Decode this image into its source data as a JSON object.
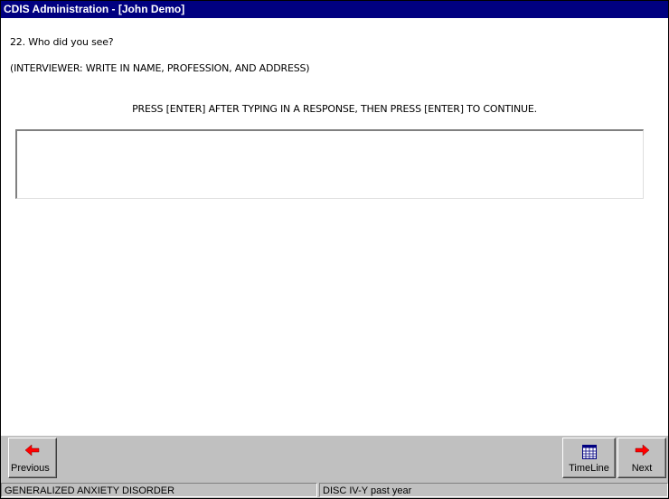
{
  "window": {
    "title": "CDIS Administration - [John Demo]"
  },
  "question": {
    "text": "22. Who did you see?",
    "instruction": "(INTERVIEWER: WRITE IN NAME, PROFESSION, AND ADDRESS)",
    "press_instruction": "PRESS [ENTER] AFTER TYPING IN A RESPONSE, THEN PRESS [ENTER] TO CONTINUE.",
    "response_value": ""
  },
  "toolbar": {
    "previous_label": "Previous",
    "previous_icon": "left-arrow-icon",
    "timeline_label": "TimeLine",
    "timeline_icon": "calendar-icon",
    "next_label": "Next",
    "next_icon": "right-arrow-icon"
  },
  "status": {
    "section": "GENERALIZED ANXIETY DISORDER",
    "module": "DISC IV-Y past year"
  },
  "colors": {
    "titlebar": "#000080",
    "arrow": "#ff0000",
    "face": "#c0c0c0"
  }
}
